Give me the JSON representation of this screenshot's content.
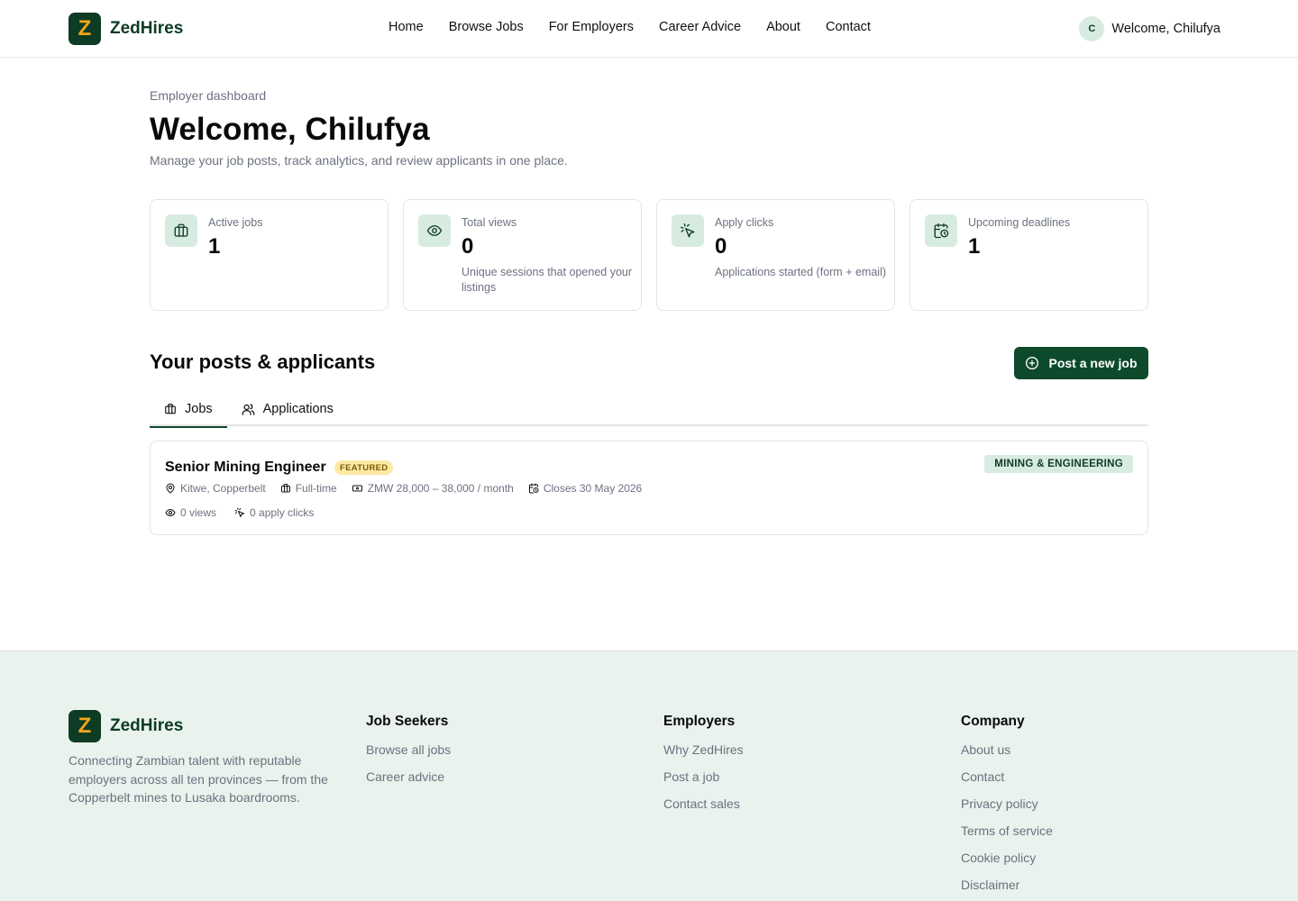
{
  "header": {
    "brand_letter": "Z",
    "brand_name": "ZedHires",
    "nav": [
      "Home",
      "Browse Jobs",
      "For Employers",
      "Career Advice",
      "About",
      "Contact"
    ],
    "user_initial": "C",
    "user_greeting": "Welcome, Chilufya"
  },
  "dashboard": {
    "eyebrow": "Employer dashboard",
    "title": "Welcome, Chilufya",
    "subtitle": "Manage your job posts, track analytics, and review applicants in one place."
  },
  "stats": [
    {
      "label": "Active jobs",
      "value": "1",
      "note": "",
      "icon": "briefcase-icon"
    },
    {
      "label": "Total views",
      "value": "0",
      "note": "Unique sessions that opened your listings",
      "icon": "eye-icon"
    },
    {
      "label": "Apply clicks",
      "value": "0",
      "note": "Applications started (form + email)",
      "icon": "cursor-click-icon"
    },
    {
      "label": "Upcoming deadlines",
      "value": "1",
      "note": "",
      "icon": "calendar-clock-icon"
    }
  ],
  "posts": {
    "section_title": "Your posts & applicants",
    "post_button": "Post a new job",
    "tabs": [
      {
        "label": "Jobs",
        "icon": "briefcase-icon"
      },
      {
        "label": "Applications",
        "icon": "users-icon"
      }
    ]
  },
  "job": {
    "title": "Senior Mining Engineer",
    "featured": "FEATURED",
    "category": "MINING & ENGINEERING",
    "location": "Kitwe, Copperbelt",
    "type": "Full-time",
    "salary": "ZMW 28,000 – 38,000 / month",
    "closes": "Closes 30 May 2026",
    "views": "0 views",
    "apply_clicks": "0 apply clicks"
  },
  "footer": {
    "brand_letter": "Z",
    "brand_name": "ZedHires",
    "description": "Connecting Zambian talent with reputable employers across all ten provinces — from the Copperbelt mines to Lusaka boardrooms.",
    "columns": [
      {
        "title": "Job Seekers",
        "links": [
          "Browse all jobs",
          "Career advice"
        ]
      },
      {
        "title": "Employers",
        "links": [
          "Why ZedHires",
          "Post a job",
          "Contact sales"
        ]
      },
      {
        "title": "Company",
        "links": [
          "About us",
          "Contact",
          "Privacy policy",
          "Terms of service",
          "Cookie policy",
          "Disclaimer"
        ]
      }
    ]
  },
  "colors": {
    "brand_dark": "#0d3b24",
    "brand_accent": "#f2a51a",
    "button": "#0d4a2b",
    "icon_bg": "#d8ebe0",
    "footer_bg": "#e9f2ec",
    "featured_bg": "#fde9a3"
  }
}
